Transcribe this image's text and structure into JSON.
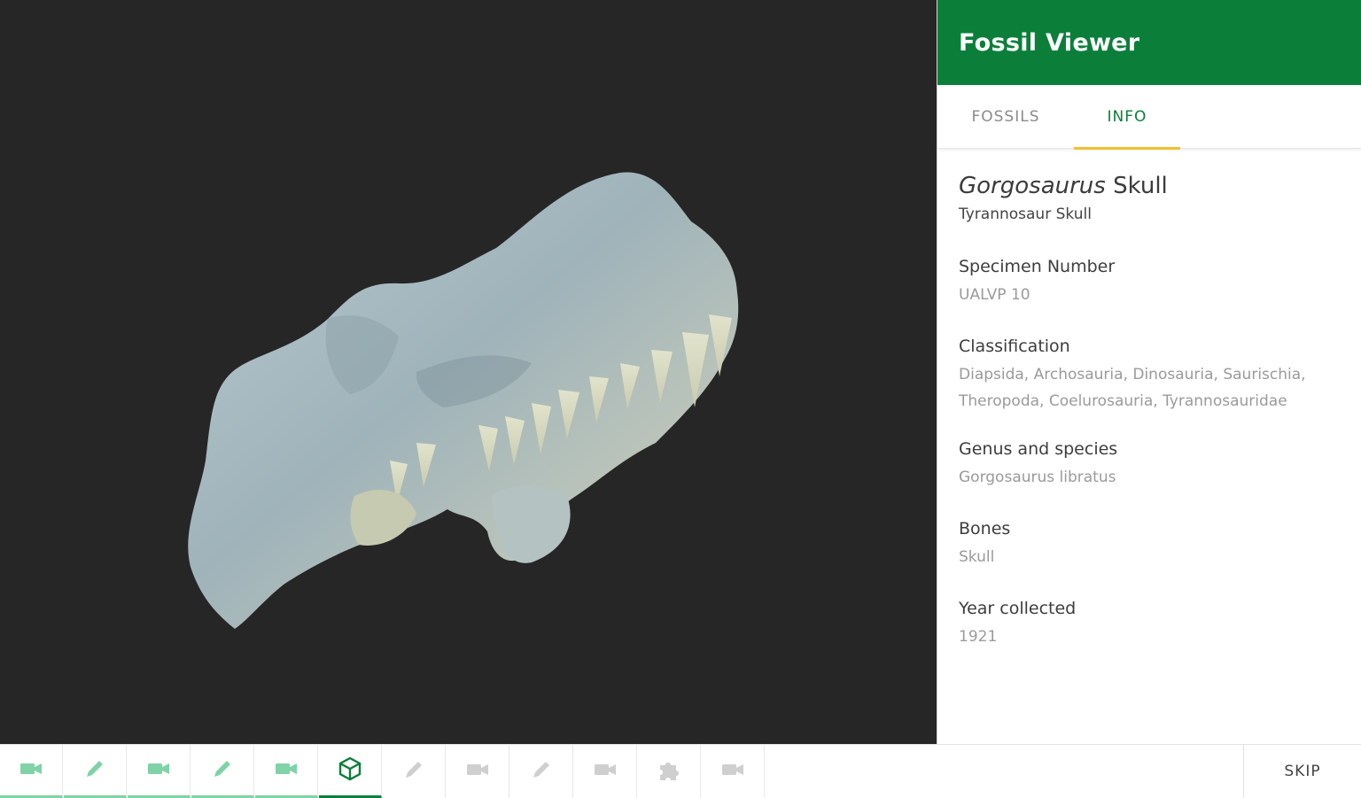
{
  "app": {
    "title": "Fossil Viewer",
    "brand_color": "#0b7f3a",
    "tab_indicator_color": "#f2c12e"
  },
  "tabs": [
    {
      "label": "FOSSILS",
      "active": false
    },
    {
      "label": "INFO",
      "active": true
    }
  ],
  "specimen": {
    "title_genus": "Gorgosaurus",
    "title_rest": " Skull",
    "subtitle": "Tyrannosaur Skull",
    "fields": [
      {
        "label": "Specimen Number",
        "value": "UALVP 10"
      },
      {
        "label": "Classification",
        "value": "Diapsida, Archosauria, Dinosauria, Saurischia, Theropoda, Coelurosauria, Tyrannosauridae"
      },
      {
        "label": "Genus and species",
        "value": "Gorgosaurus libratus"
      },
      {
        "label": "Bones",
        "value": "Skull"
      },
      {
        "label": "Year collected",
        "value": "1921"
      }
    ]
  },
  "viewport": {
    "background": "#262626",
    "subject": "3d-skull-model"
  },
  "bottom_bar": {
    "steps": [
      {
        "icon": "video-camera-icon",
        "state": "done"
      },
      {
        "icon": "pencil-icon",
        "state": "done"
      },
      {
        "icon": "video-camera-icon",
        "state": "done"
      },
      {
        "icon": "pencil-icon",
        "state": "done"
      },
      {
        "icon": "video-camera-icon",
        "state": "done"
      },
      {
        "icon": "cube-icon",
        "state": "active"
      },
      {
        "icon": "pencil-icon",
        "state": "pending"
      },
      {
        "icon": "video-camera-icon",
        "state": "pending"
      },
      {
        "icon": "pencil-icon",
        "state": "pending"
      },
      {
        "icon": "video-camera-icon",
        "state": "pending"
      },
      {
        "icon": "puzzle-piece-icon",
        "state": "pending"
      },
      {
        "icon": "video-camera-icon",
        "state": "pending"
      }
    ],
    "skip_label": "SKIP",
    "done_color": "#7fd3a6",
    "pending_color": "#cfcfcf"
  }
}
